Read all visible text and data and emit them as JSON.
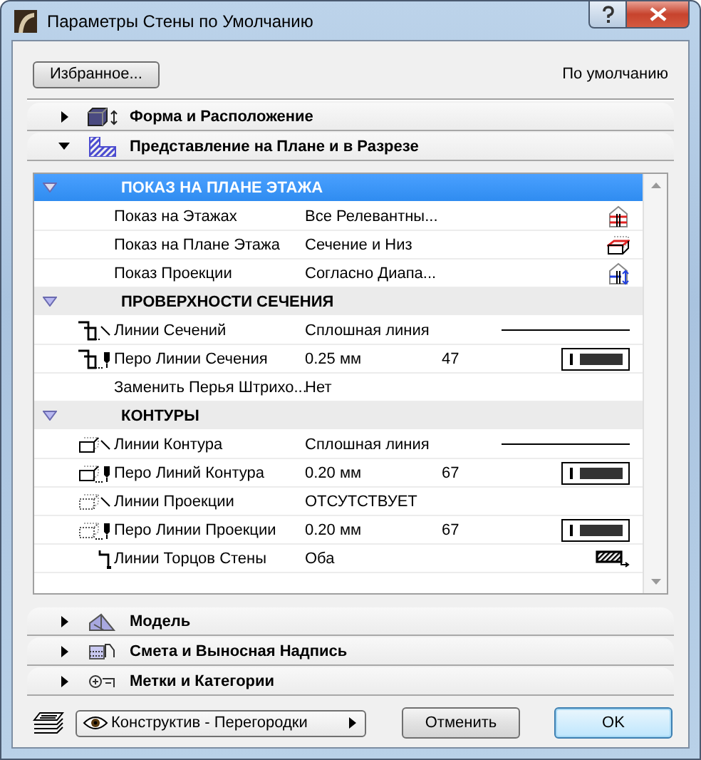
{
  "window": {
    "title": "Параметры Стены по Умолчанию"
  },
  "favorites_button": "Избранное...",
  "default_label": "По умолчанию",
  "panels_top": [
    {
      "title": "Форма и Расположение",
      "expanded": false,
      "kind": "shape"
    },
    {
      "title": "Представление на Плане и в Разрезе",
      "expanded": true,
      "kind": "plan"
    }
  ],
  "settings": [
    {
      "title": "ПОКАЗ НА ПЛАНЕ ЭТАЖА",
      "expanded": true,
      "selected": true,
      "rows": [
        {
          "label": "Показ на Этажах",
          "value": "Все Релевантны...",
          "kind": "stories"
        },
        {
          "label": "Показ на Плане Этажа",
          "value": "Сечение и Низ",
          "kind": "floorplan"
        },
        {
          "label": "Показ Проекции",
          "value": "Согласно Диапа...",
          "kind": "projection"
        }
      ]
    },
    {
      "title": "ПРОВЕРХНОСТИ СЕЧЕНИЯ",
      "expanded": true,
      "selected": false,
      "rows": [
        {
          "label": "Линии Сечений",
          "value": "Сплошная линия",
          "kind": "cutline"
        },
        {
          "label": "Перо Линии Сечения",
          "value": "0.25 мм",
          "number": "47",
          "kind": "cutpen"
        },
        {
          "label": "Заменить Перья Штрихо...",
          "value": "Нет",
          "kind": "plain"
        }
      ]
    },
    {
      "title": "КОНТУРЫ",
      "expanded": true,
      "selected": false,
      "rows": [
        {
          "label": "Линии Контура",
          "value": "Сплошная линия",
          "kind": "contourline"
        },
        {
          "label": "Перо Линий Контура",
          "value": "0.20 мм",
          "number": "67",
          "kind": "contourpen"
        },
        {
          "label": "Линии Проекции",
          "value": "ОТСУТСТВУЕТ",
          "kind": "projline"
        },
        {
          "label": "Перо Линии Проекции",
          "value": "0.20 мм",
          "number": "67",
          "kind": "projpen"
        },
        {
          "label": "Линии Торцов Стены",
          "value": "Оба",
          "kind": "wallend"
        }
      ]
    }
  ],
  "panels_bottom": [
    {
      "title": "Модель",
      "expanded": false,
      "kind": "model"
    },
    {
      "title": "Смета и Выносная Надпись",
      "expanded": false,
      "kind": "listing"
    },
    {
      "title": "Метки и Категории",
      "expanded": false,
      "kind": "tags"
    }
  ],
  "layer_menu": "Конструктив - Перегородки",
  "buttons": [
    {
      "label": "Отменить",
      "default": false
    },
    {
      "label": "OK",
      "default": true
    }
  ]
}
